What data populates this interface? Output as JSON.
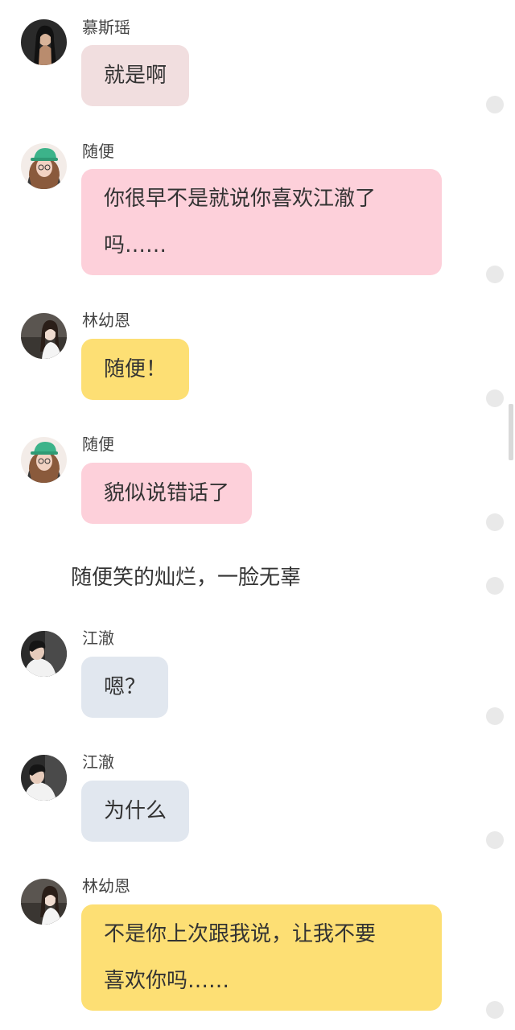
{
  "colors": {
    "bubble_musiyao": "#f1dedf",
    "bubble_suibian": "#fdd0da",
    "bubble_linyouen": "#fddf74",
    "bubble_jiangche": "#e1e7ef",
    "dot": "#e9e9e9"
  },
  "messages": [
    {
      "sender": "慕斯瑶",
      "text": "就是啊",
      "avatar": "woman-dark-hair-avatar"
    },
    {
      "sender": "随便",
      "text": "你很早不是就说你喜欢江澈了\n吗……",
      "avatar": "girl-green-cap-avatar"
    },
    {
      "sender": "林幼恩",
      "text": "随便！",
      "avatar": "girl-long-hair-avatar"
    },
    {
      "sender": "随便",
      "text": "貌似说错话了",
      "avatar": "girl-green-cap-avatar"
    },
    {
      "sender": "江澈",
      "text": "嗯？",
      "avatar": "boy-white-shirt-avatar"
    },
    {
      "sender": "江澈",
      "text": "为什么",
      "avatar": "boy-white-shirt-avatar"
    },
    {
      "sender": "林幼恩",
      "text": "不是你上次跟我说，让我不要\n喜欢你吗……",
      "avatar": "girl-long-hair-avatar"
    }
  ],
  "narration": "随便笑的灿烂，一脸无辜"
}
